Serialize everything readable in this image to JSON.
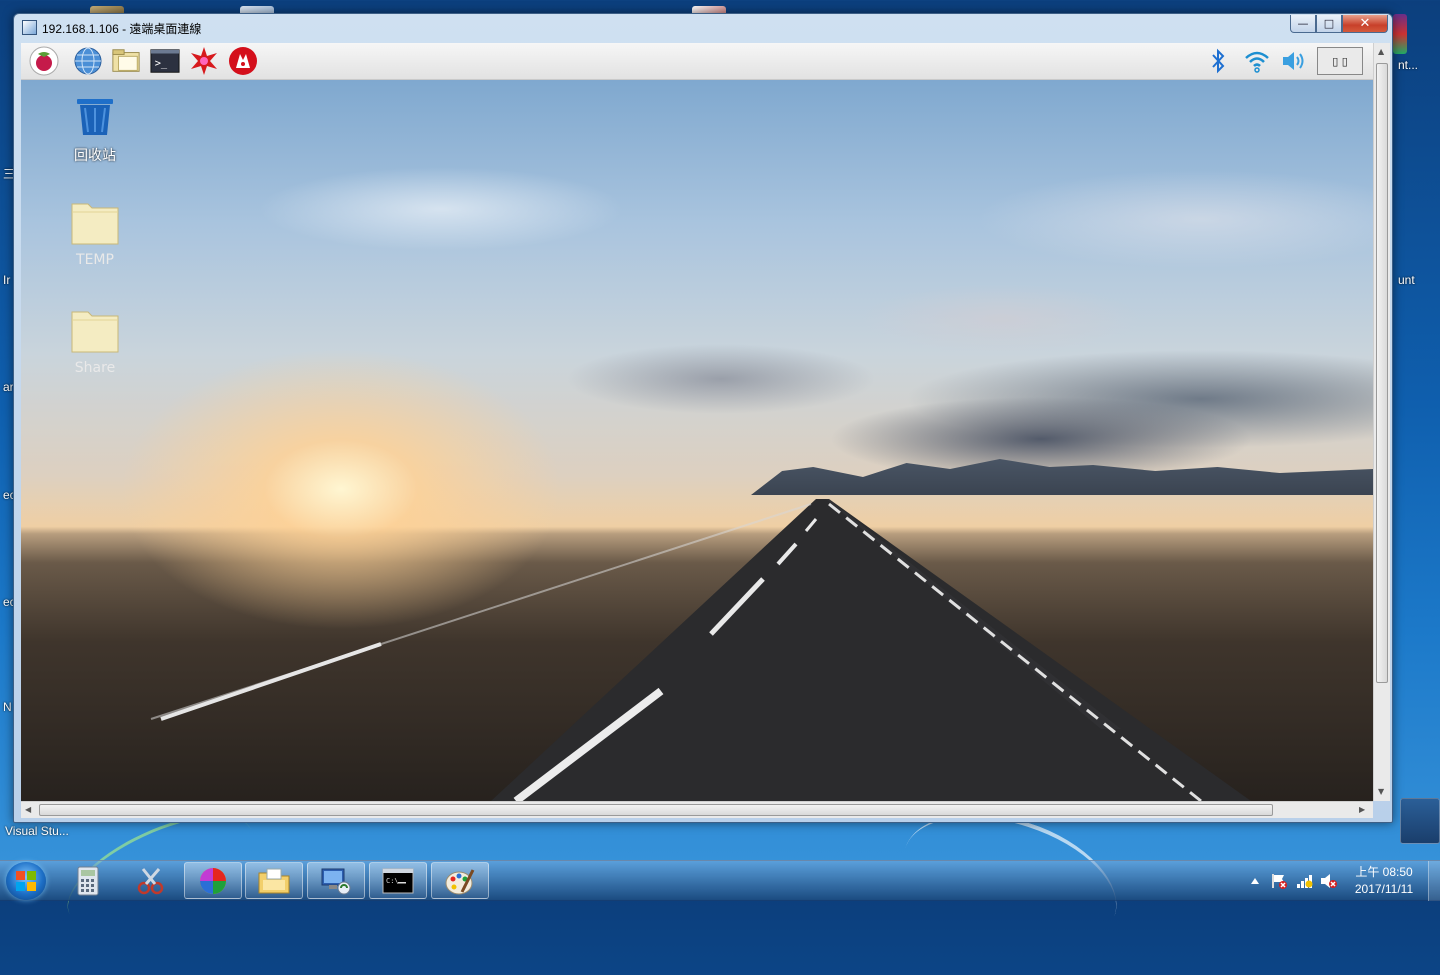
{
  "host": {
    "edge_texts": [
      {
        "text": "nt...",
        "side": "right"
      },
      {
        "text": "unt",
        "side": "right"
      },
      {
        "text": "Visual Stu...",
        "side": "left"
      },
      {
        "text": "三",
        "side": "left"
      },
      {
        "text": "Ir",
        "side": "left"
      },
      {
        "text": "ar",
        "side": "left"
      },
      {
        "text": "ec",
        "side": "left"
      },
      {
        "text": "ec",
        "side": "left"
      },
      {
        "text": "N",
        "side": "left"
      }
    ]
  },
  "window": {
    "title": "192.168.1.106 - 遠端桌面連線",
    "minimize": "—",
    "maximize": "□",
    "close": "✕"
  },
  "remote": {
    "panel_launchers": [
      {
        "icon": "raspberry-menu-icon"
      },
      {
        "icon": "web-browser-icon"
      },
      {
        "icon": "file-manager-icon"
      },
      {
        "icon": "terminal-icon"
      },
      {
        "icon": "math-kernel-icon"
      },
      {
        "icon": "wolfram-icon"
      }
    ],
    "tray": {
      "bluetooth": "bluetooth-icon",
      "wifi": "wifi-icon",
      "volume": "volume-icon",
      "cpu_box_text": "▯ ▯"
    },
    "desktop_icons": [
      {
        "label": "回收站",
        "icon": "trash-icon"
      },
      {
        "label": "TEMP",
        "icon": "folder-icon"
      },
      {
        "label": "Share",
        "icon": "folder-icon"
      }
    ]
  },
  "taskbar": {
    "items": [
      {
        "icon": "calculator-icon",
        "active": false
      },
      {
        "icon": "snipping-tool-icon",
        "active": false
      },
      {
        "icon": "color-picker-icon",
        "active": true
      },
      {
        "icon": "explorer-icon",
        "active": true
      },
      {
        "icon": "remote-desktop-icon",
        "active": true
      },
      {
        "icon": "cmd-icon",
        "active": true
      },
      {
        "icon": "paint-icon",
        "active": true
      }
    ],
    "clock": {
      "time": "上午 08:50",
      "date": "2017/11/11"
    },
    "tray_icons": [
      "show-hidden-icon",
      "action-center-flag-icon",
      "network-icon",
      "volume-muted-icon"
    ]
  }
}
